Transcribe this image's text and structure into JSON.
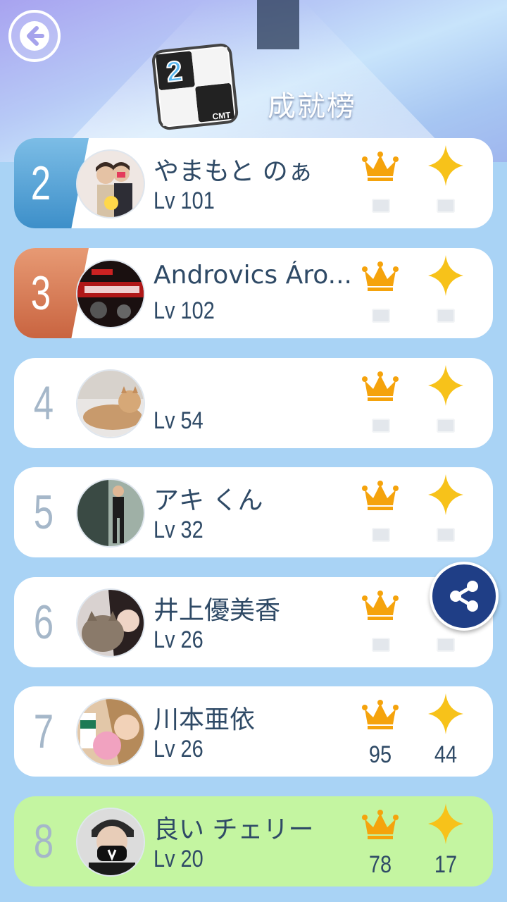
{
  "header": {
    "title": "成就榜",
    "logo_digit": "2",
    "logo_brand": "CMT",
    "back_icon": "arrow-left-icon",
    "share_icon": "share-icon"
  },
  "colors": {
    "rank2_badge": "#3d8fc9",
    "rank3_badge": "#c96440",
    "current_user_row": "#c4f5a1",
    "crown": "#f5a30c",
    "star": "#f7c21a"
  },
  "leaderboard": [
    {
      "rank": "2",
      "name": "やまもと のぁ",
      "level": "Lv 101",
      "crowns": "",
      "stars": ""
    },
    {
      "rank": "3",
      "name": "Androvics Áro...",
      "level": "Lv 102",
      "crowns": "",
      "stars": ""
    },
    {
      "rank": "4",
      "name": "",
      "level": "Lv 54",
      "crowns": "",
      "stars": ""
    },
    {
      "rank": "5",
      "name": "アキ くん",
      "level": "Lv 32",
      "crowns": "",
      "stars": ""
    },
    {
      "rank": "6",
      "name": "井上優美香",
      "level": "Lv 26",
      "crowns": "",
      "stars": ""
    },
    {
      "rank": "7",
      "name": "川本亜依",
      "level": "Lv 26",
      "crowns": "95",
      "stars": "44"
    },
    {
      "rank": "8",
      "name": "良い チェリー",
      "level": "Lv 20",
      "crowns": "78",
      "stars": "17"
    }
  ]
}
